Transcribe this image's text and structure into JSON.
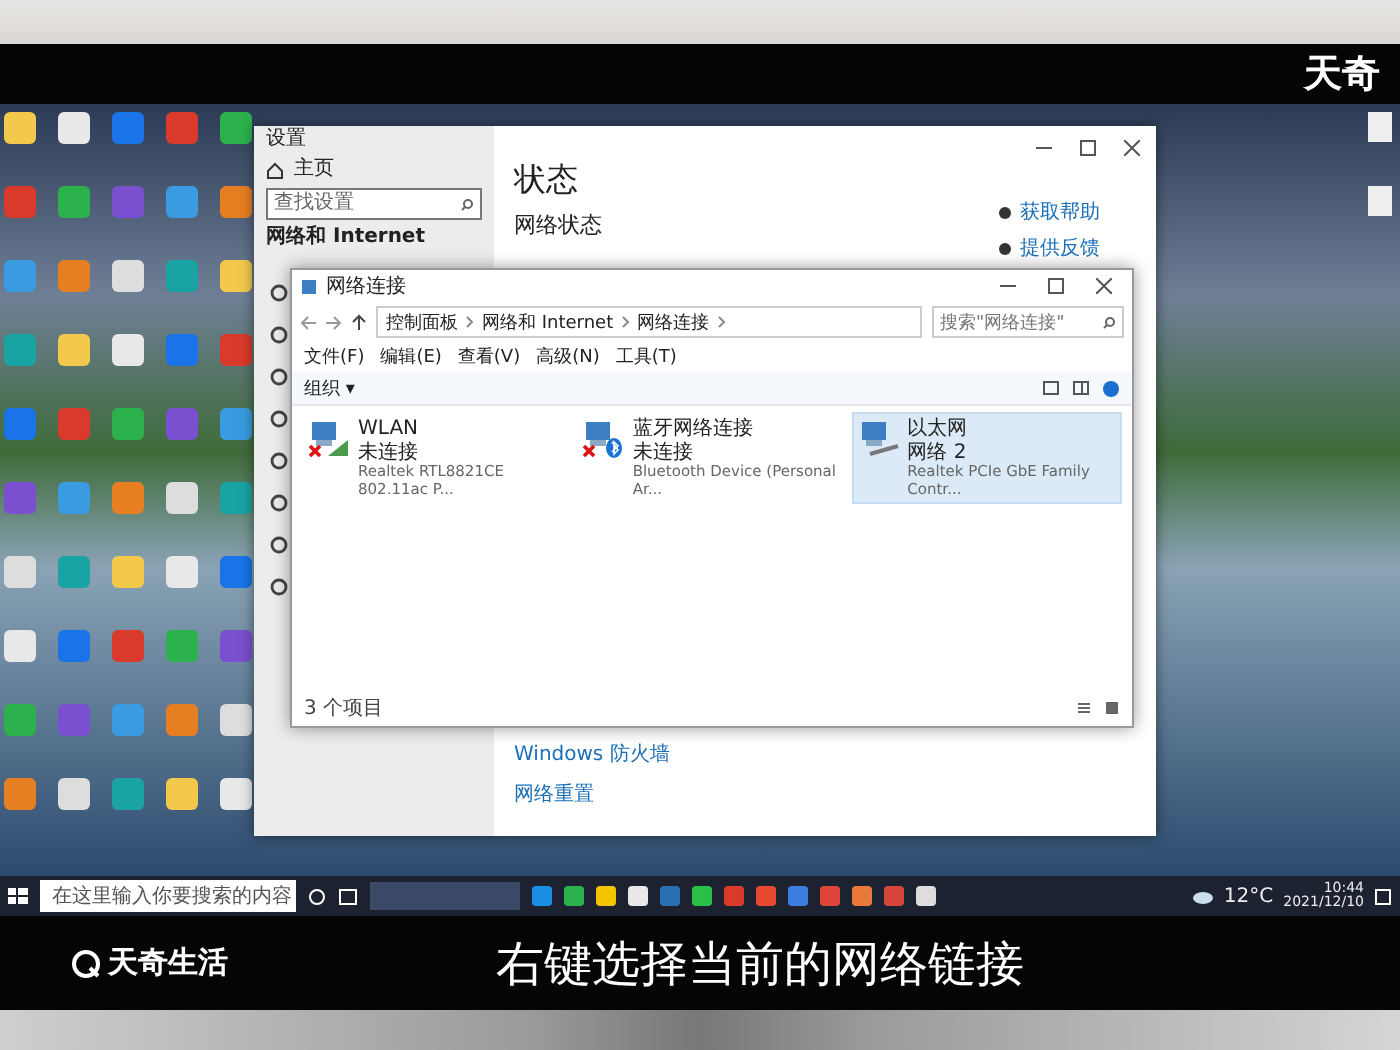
{
  "top_brand": "天奇",
  "settings": {
    "title": "设置",
    "home": "主页",
    "search_placeholder": "查找设置",
    "section": "网络和 Internet",
    "heading": "状态",
    "subheading": "网络状态",
    "help_links": [
      "获取帮助",
      "提供反馈"
    ],
    "bottom_links": [
      "Windows 防火墙",
      "网络重置"
    ]
  },
  "network_window": {
    "title": "网络连接",
    "breadcrumb": [
      "控制面板",
      "网络和 Internet",
      "网络连接"
    ],
    "search_placeholder": "搜索\"网络连接\"",
    "menu": [
      "文件(F)",
      "编辑(E)",
      "查看(V)",
      "高级(N)",
      "工具(T)"
    ],
    "organize": "组织 ▾",
    "items": [
      {
        "kind": "wifi",
        "name": "WLAN",
        "status": "未连接",
        "device": "Realtek RTL8821CE 802.11ac P...",
        "connected": false,
        "selected": false
      },
      {
        "kind": "bluetooth",
        "name": "蓝牙网络连接",
        "status": "未连接",
        "device": "Bluetooth Device (Personal Ar...",
        "connected": false,
        "selected": false
      },
      {
        "kind": "ethernet",
        "name": "以太网",
        "status": "网络 2",
        "device": "Realtek PCIe GbE Family Contr...",
        "connected": true,
        "selected": true
      }
    ],
    "status_bar": "3 个项目"
  },
  "taskbar": {
    "search_placeholder": "在这里输入你要搜索的内容",
    "temperature": "12°C",
    "time": "10:44",
    "date": "2021/12/10"
  },
  "caption": {
    "brand": "天奇生活",
    "subtitle": "右键选择当前的网络链接"
  }
}
